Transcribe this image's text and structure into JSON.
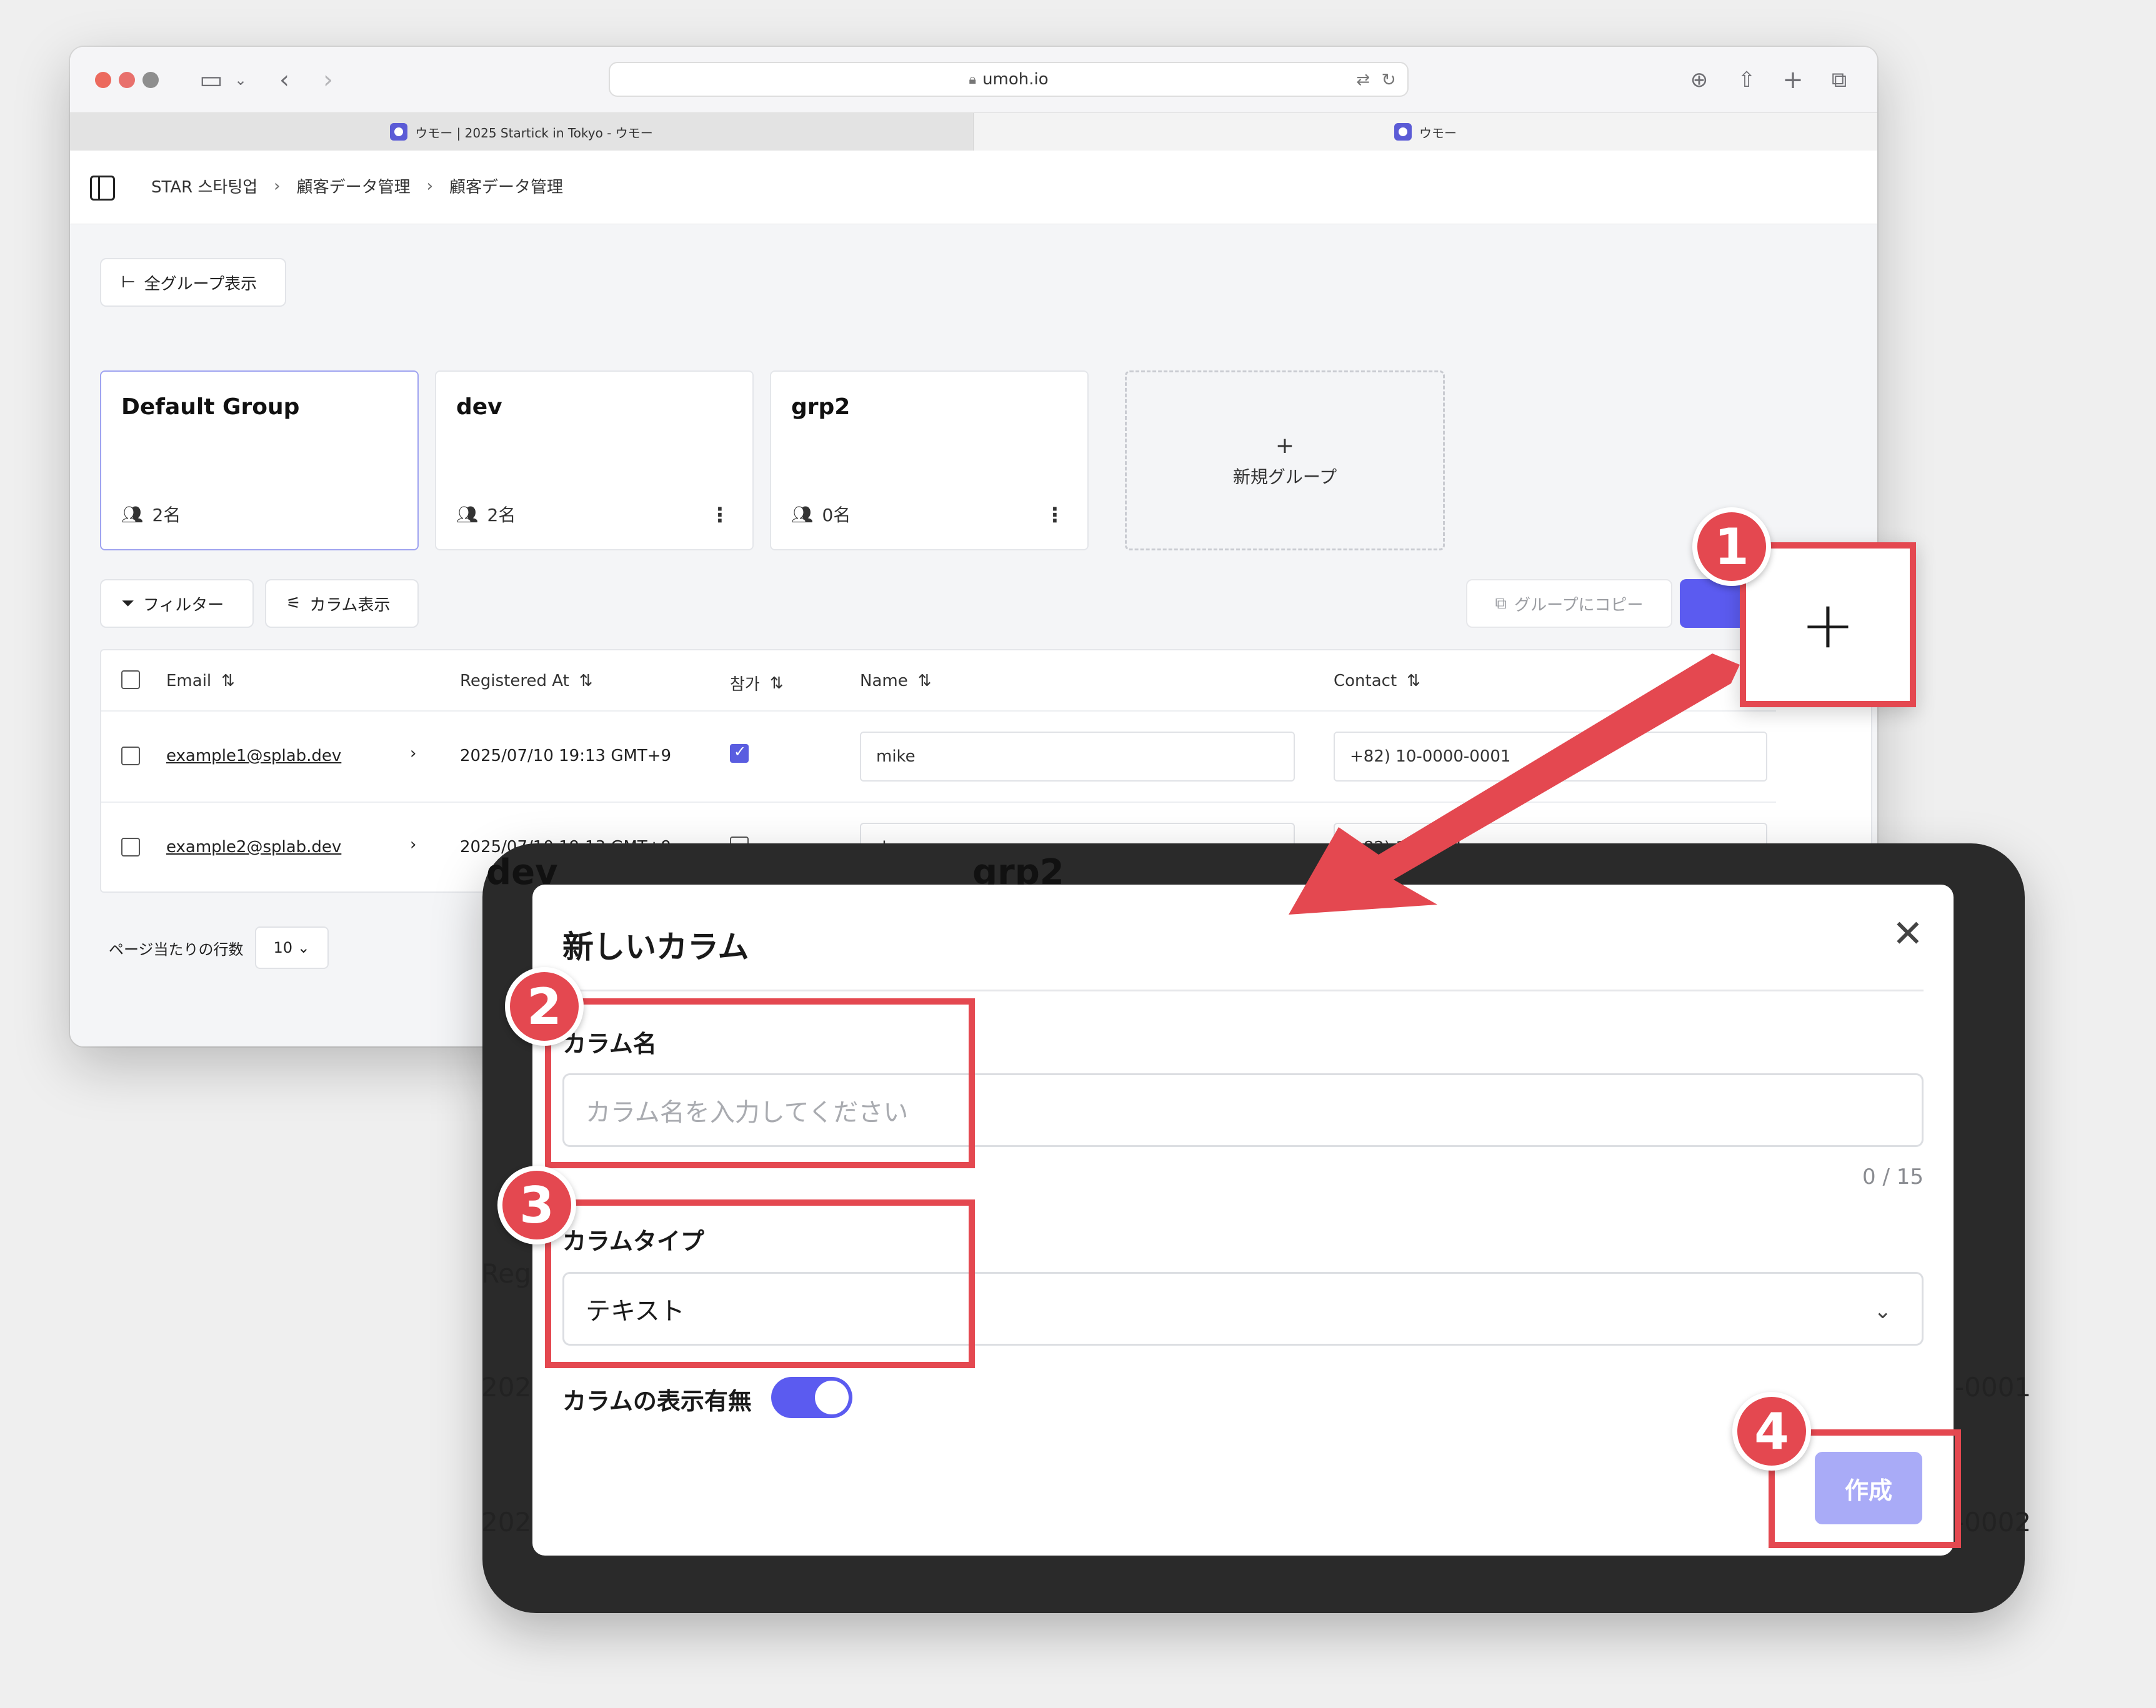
{
  "browser": {
    "url": "umoh.io",
    "tabs": [
      {
        "label": "ウモー | 2025 Startick in Tokyo - ウモー"
      },
      {
        "label": "ウモー"
      }
    ]
  },
  "breadcrumb": [
    "STAR 스타팅업",
    "顧客データ管理",
    "顧客データ管理"
  ],
  "show_all_groups": "全グループ表示",
  "groups": [
    {
      "name": "Default Group",
      "count": "2名"
    },
    {
      "name": "dev",
      "count": "2名"
    },
    {
      "name": "grp2",
      "count": "0名"
    }
  ],
  "new_group": {
    "plus": "+",
    "label": "新規グループ"
  },
  "toolbar": {
    "filter": "フィルター",
    "columns": "カラム表示",
    "copy": "グループにコピー"
  },
  "table": {
    "headers": [
      "Email",
      "Registered At",
      "참가",
      "Name",
      "Contact"
    ],
    "rows": [
      {
        "email": "example1@splab.dev",
        "registered": "2025/07/10 19:13 GMT+9",
        "joined": true,
        "name": "mike",
        "contact": "+82) 10-0000-0001"
      },
      {
        "email": "example2@splab.dev",
        "registered": "2025/07/10 19:13 GMT+9",
        "joined": false,
        "name": "does",
        "contact": "+82) 10-0001"
      }
    ]
  },
  "pager": {
    "label": "ページ当たりの行数",
    "value": "10"
  },
  "callout": {
    "plus": "+"
  },
  "modal": {
    "title": "新しいカラム",
    "name_label": "カラム名",
    "name_placeholder": "カラム名を入力してください",
    "counter": "0 / 15",
    "type_label": "カラムタイプ",
    "type_value": "テキスト",
    "visibility_label": "カラムの表示有無",
    "visibility_on": true,
    "create_button": "作成"
  },
  "background_fragments": {
    "dev": "dev",
    "grp2": "grp2",
    "regi": "Regi",
    "y1": "2025",
    "y2": "2025",
    "c1": "-0001",
    "c2": "-0002"
  },
  "steps": [
    "1",
    "2",
    "3",
    "4"
  ],
  "colors": {
    "accent": "#5b5bf0",
    "highlight": "#e44850",
    "create_disabled": "#a9abf7"
  }
}
